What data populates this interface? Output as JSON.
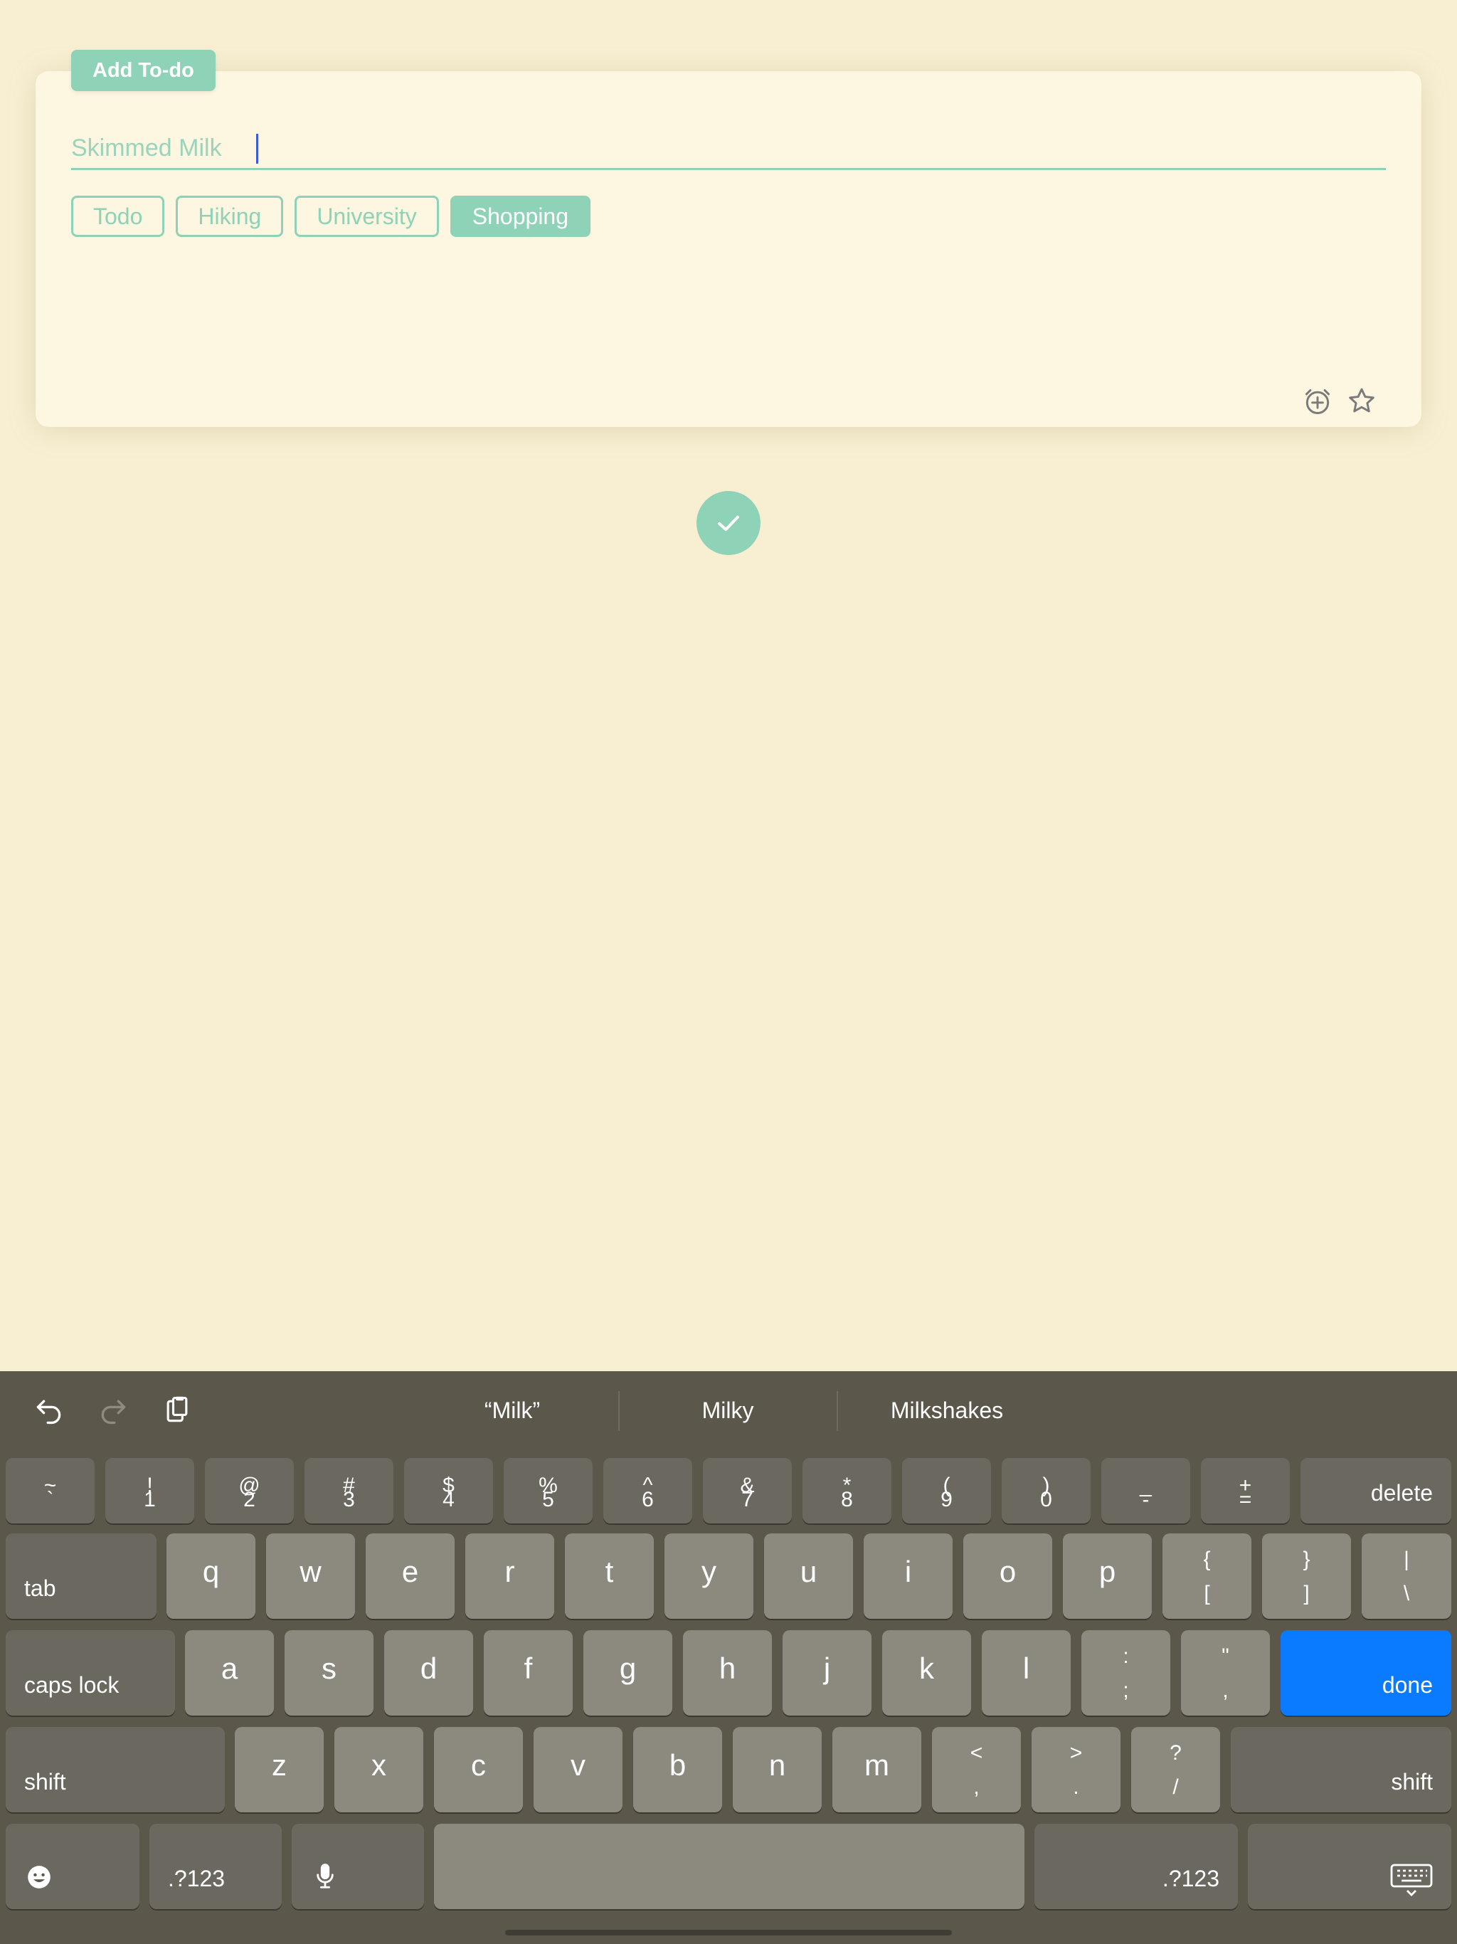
{
  "card": {
    "tag": "Add To-do",
    "input_value": "Skimmed Milk",
    "chips": [
      {
        "label": "Todo",
        "active": false
      },
      {
        "label": "Hiking",
        "active": false
      },
      {
        "label": "University",
        "active": false
      },
      {
        "label": "Shopping",
        "active": true
      }
    ],
    "icons": [
      "alarm-add-icon",
      "star-icon"
    ]
  },
  "colors": {
    "background": "#f8efd3",
    "card": "#fdf6e1",
    "accent": "#8ed2b7",
    "keyboard": "#5b574b",
    "done_key": "#0a7aff"
  },
  "keyboard": {
    "toolbar_icons": [
      "undo-icon",
      "redo-icon",
      "paste-icon"
    ],
    "suggestions": [
      "“Milk”",
      "Milky",
      "Milkshakes"
    ],
    "row1": [
      {
        "top": "~",
        "bottom": "`"
      },
      {
        "top": "!",
        "bottom": "1"
      },
      {
        "top": "@",
        "bottom": "2"
      },
      {
        "top": "#",
        "bottom": "3"
      },
      {
        "top": "$",
        "bottom": "4"
      },
      {
        "top": "%",
        "bottom": "5"
      },
      {
        "top": "^",
        "bottom": "6"
      },
      {
        "top": "&",
        "bottom": "7"
      },
      {
        "top": "*",
        "bottom": "8"
      },
      {
        "top": "(",
        "bottom": "9"
      },
      {
        "top": ")",
        "bottom": "0"
      },
      {
        "top": "_",
        "bottom": "-"
      },
      {
        "top": "+",
        "bottom": "="
      }
    ],
    "delete": "delete",
    "tab": "tab",
    "row2": [
      "q",
      "w",
      "e",
      "r",
      "t",
      "y",
      "u",
      "i",
      "o",
      "p"
    ],
    "row2_sym": [
      {
        "top": "{",
        "bottom": "["
      },
      {
        "top": "}",
        "bottom": "]"
      },
      {
        "top": "|",
        "bottom": "\\"
      }
    ],
    "caps_lock": "caps lock",
    "row3": [
      "a",
      "s",
      "d",
      "f",
      "g",
      "h",
      "j",
      "k",
      "l"
    ],
    "row3_sym": [
      {
        "top": ":",
        "bottom": ";"
      },
      {
        "top": "\"",
        "bottom": ","
      }
    ],
    "done": "done",
    "shift": "shift",
    "row4": [
      "z",
      "x",
      "c",
      "v",
      "b",
      "n",
      "m"
    ],
    "row4_sym": [
      {
        "top": "<",
        "bottom": ","
      },
      {
        "top": ">",
        "bottom": "."
      },
      {
        "top": "?",
        "bottom": "/"
      }
    ],
    "numbers": ".?123"
  }
}
